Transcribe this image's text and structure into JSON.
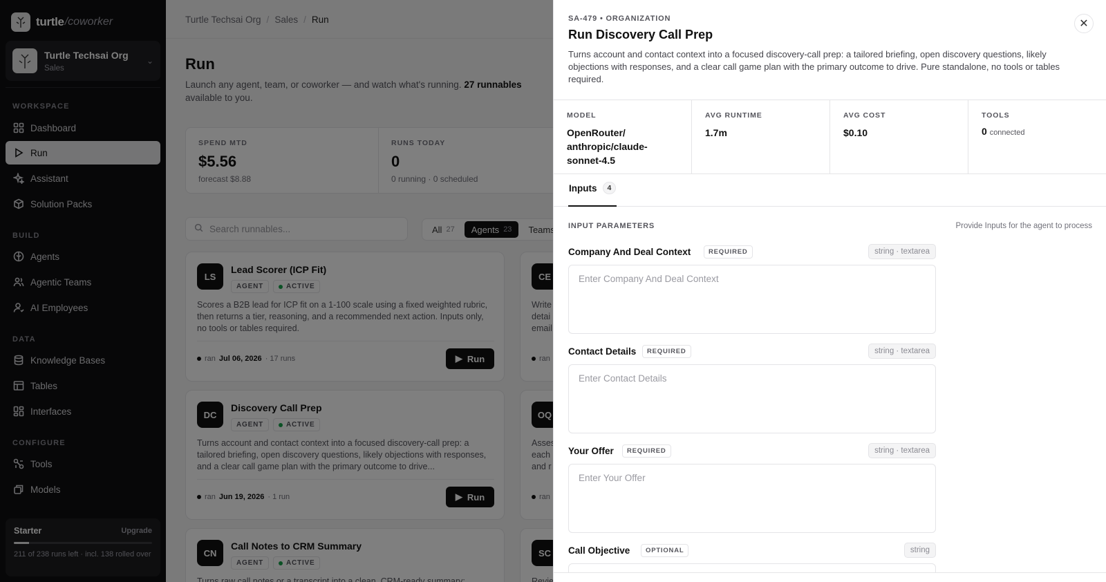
{
  "brand": {
    "name": "turtle",
    "sub": "/coworker"
  },
  "org": {
    "name": "Turtle Techsai Org",
    "sub": "Sales"
  },
  "sidebar": {
    "sections": {
      "workspace": "WORKSPACE",
      "build": "BUILD",
      "data": "DATA",
      "configure": "CONFIGURE"
    },
    "items": [
      {
        "label": "Dashboard",
        "icon": "dashboard-icon"
      },
      {
        "label": "Run",
        "icon": "play-icon",
        "active": true
      },
      {
        "label": "Assistant",
        "icon": "sparkle-icon"
      },
      {
        "label": "Solution Packs",
        "icon": "package-icon"
      },
      {
        "label": "Agents",
        "icon": "agent-icon"
      },
      {
        "label": "Agentic Teams",
        "icon": "team-icon"
      },
      {
        "label": "AI Employees",
        "icon": "employee-icon"
      },
      {
        "label": "Knowledge Bases",
        "icon": "database-icon"
      },
      {
        "label": "Tables",
        "icon": "table-icon"
      },
      {
        "label": "Interfaces",
        "icon": "interface-icon"
      },
      {
        "label": "Tools",
        "icon": "tools-icon"
      },
      {
        "label": "Models",
        "icon": "model-icon"
      }
    ]
  },
  "plan": {
    "name": "Starter",
    "upgrade": "Upgrade",
    "progress_fraction": 0.11,
    "note": "211 of 238 runs left · incl. 138 rolled over"
  },
  "breadcrumb": [
    "Turtle Techsai Org",
    "Sales",
    "Run"
  ],
  "page": {
    "title": "Run",
    "desc_pre": "Launch any agent, team, or coworker — and watch what's running.",
    "desc_bold": "27 runnables",
    "desc_post": "available to you."
  },
  "stats": [
    {
      "label": "SPEND MTD",
      "value": "$5.56",
      "sub": "forecast $8.88"
    },
    {
      "label": "RUNS TODAY",
      "value": "0",
      "sub": "0 running · 0 scheduled"
    }
  ],
  "search": {
    "placeholder": "Search runnables..."
  },
  "filters": [
    {
      "label": "All",
      "count": "27"
    },
    {
      "label": "Agents",
      "count": "23",
      "active": true
    },
    {
      "label": "Teams",
      "count": ""
    }
  ],
  "cards": [
    {
      "abbr": "LS",
      "title": "Lead Scorer (ICP Fit)",
      "type": "AGENT",
      "status": "ACTIVE",
      "desc": "Scores a B2B lead for ICP fit on a 1-100 scale using a fixed weighted rubric, then returns a tier, reasoning, and a recommended next action. Inputs only, no tools or tables required.",
      "meta_pre": "ran",
      "date": "Jul 06, 2026",
      "runs": "· 17 runs",
      "run_label": "Run"
    },
    {
      "abbr": "DC",
      "title": "Discovery Call Prep",
      "type": "AGENT",
      "status": "ACTIVE",
      "desc": "Turns account and contact context into a focused discovery-call prep: a tailored briefing, open discovery questions, likely objections with responses, and a clear call game plan with the primary outcome to drive...",
      "meta_pre": "ran",
      "date": "Jun 19, 2026",
      "runs": "· 1 run",
      "run_label": "Run"
    },
    {
      "abbr": "CN",
      "title": "Call Notes to CRM Summary",
      "type": "AGENT",
      "status": "ACTIVE",
      "desc": "Turns raw call notes or a transcript into a clean, CRM-ready summary:"
    }
  ],
  "side_cards": [
    {
      "abbr": "CE",
      "desc": "Write detai email",
      "meta_pre": "ran"
    },
    {
      "abbr": "OQ",
      "desc": "Asses each and r",
      "meta_pre": "ran"
    },
    {
      "abbr": "SC",
      "desc": "Revie"
    }
  ],
  "drawer": {
    "kicker": "SA-479 • ORGANIZATION",
    "title": "Run Discovery Call Prep",
    "desc": "Turns account and contact context into a focused discovery-call prep: a tailored briefing, open discovery questions, likely objections with responses, and a clear call game plan with the primary outcome to drive. Pure standalone, no tools or tables required.",
    "close_icon": "close-icon",
    "metrics": [
      {
        "label": "MODEL",
        "value": "OpenRouter/ anthropic/claude-sonnet-4.5"
      },
      {
        "label": "AVG RUNTIME",
        "value": "1.7m"
      },
      {
        "label": "AVG COST",
        "value": "$0.10"
      },
      {
        "label": "TOOLS",
        "value": "0",
        "suffix": "connected"
      }
    ],
    "tab": {
      "label": "Inputs",
      "count": "4"
    },
    "inputs_label": "INPUT PARAMETERS",
    "inputs_hint": "Provide Inputs for the agent to process",
    "fields": [
      {
        "name": "Company And Deal Context",
        "req": "REQUIRED",
        "type": "string · textarea",
        "placeholder": "Enter Company And Deal Context"
      },
      {
        "name": "Contact Details",
        "req": "REQUIRED",
        "type": "string · textarea",
        "placeholder": "Enter Contact Details"
      },
      {
        "name": "Your Offer",
        "req": "REQUIRED",
        "type": "string · textarea",
        "placeholder": "Enter Your Offer"
      },
      {
        "name": "Call Objective",
        "req": "OPTIONAL",
        "type": "string",
        "placeholder": ""
      }
    ]
  }
}
